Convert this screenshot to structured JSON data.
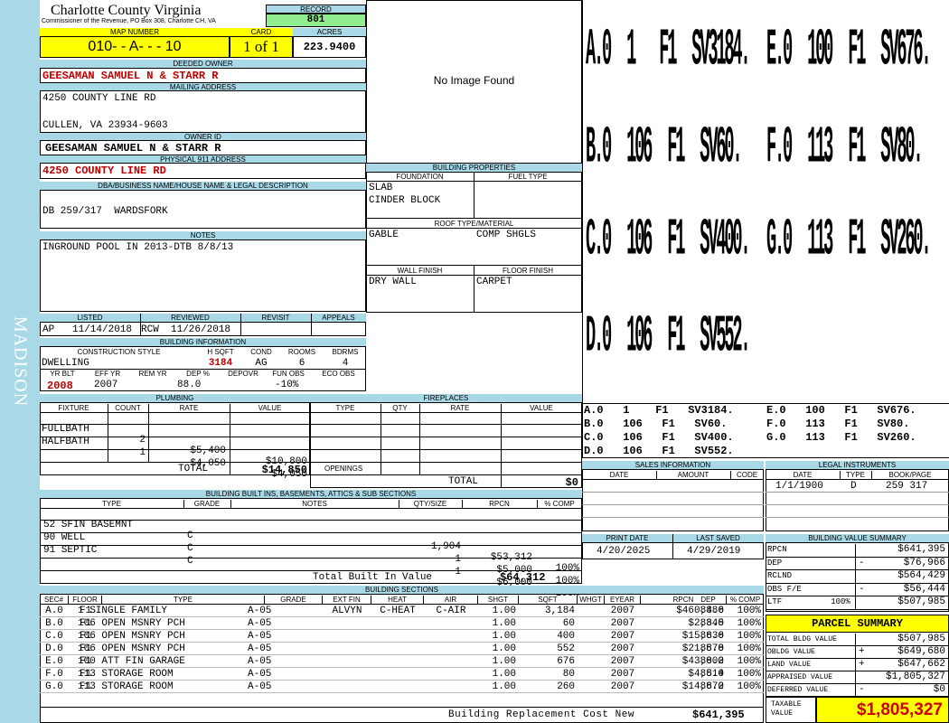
{
  "sidebar": {
    "label": "MADISON"
  },
  "header": {
    "county": "Charlotte County Virginia",
    "commissioner": "Commissioner of the Revenue, PO Box 308, Charlotte CH, VA",
    "record_label": "RECORD",
    "record": "801"
  },
  "parcel": {
    "map_label": "MAP NUMBER",
    "map": "010- - A- - - 10",
    "card_label": "CARD",
    "card": "1 of 1",
    "acres_label": "ACRES",
    "acres": "223.9400"
  },
  "owner": {
    "deeded_label": "DEEDED OWNER",
    "deeded": "GEESAMAN SAMUEL N & STARR R",
    "mailing_label": "MAILING ADDRESS",
    "mail1": "4250 COUNTY LINE RD",
    "mail2": "CULLEN, VA 23934-9603",
    "id_label": "OWNER ID",
    "id": "GEESAMAN SAMUEL N & STARR R",
    "phys_label": "PHYSICAL 911 ADDRESS",
    "phys": "4250 COUNTY LINE RD"
  },
  "dba": {
    "label": "DBA/BUSINESS NAME/HOUSE NAME & LEGAL DESCRIPTION",
    "value": "DB 259/317  WARDSFORK"
  },
  "notes": {
    "label": "NOTES",
    "value": "INGROUND POOL IN 2013-DTB 8/8/13"
  },
  "photo": {
    "text": "No Image Found"
  },
  "props": {
    "title": "BUILDING PROPERTIES",
    "foundation_label": "FOUNDATION",
    "fuel_label": "FUEL TYPE",
    "foundation1": "SLAB",
    "foundation2": "CINDER BLOCK",
    "roof_label": "ROOF TYPE/MATERIAL",
    "roof1": "GABLE",
    "roof2": "COMP SHGLS",
    "wall_label": "WALL FINISH",
    "floor_label": "FLOOR FINISH",
    "wall": "DRY WALL",
    "floor": "CARPET"
  },
  "review": {
    "listed_label": "LISTED",
    "reviewed_label": "REVIEWED",
    "revisit_label": "REVISIT",
    "appeals_label": "APPEALS",
    "listed": "AP   11/14/2018",
    "reviewed": "RCW  11/26/2018"
  },
  "bldg": {
    "title": "BUILDING INFORMATION",
    "cs_label": "CONSTRUCTION STYLE",
    "hsqft_label": "H SQFT",
    "cond_label": "COND",
    "rooms_label": "ROOMS",
    "bdrms_label": "BDRMS",
    "cs": "DWELLING",
    "hsqft": "3184",
    "cond": "AG",
    "rooms": "6",
    "bdrms": "4",
    "yrblt_label": "YR BLT",
    "effyr_label": "EFF YR",
    "remyr_label": "REM YR",
    "dep_label": "DEP %",
    "depovr_label": "DEPOVR",
    "funobs_label": "FUN OBS",
    "ecoobs_label": "ECO OBS",
    "yrblt": "2008",
    "effyr": "2007",
    "dep": "88.0",
    "funobs": "-10%"
  },
  "plumbing": {
    "title": "PLUMBING",
    "headers": [
      "FIXTURE",
      "COUNT",
      "RATE",
      "VALUE"
    ],
    "rows": [
      [
        "FULLBATH",
        "2",
        "$5,400",
        "$10,800"
      ],
      [
        "HALFBATH",
        "1",
        "$4,050",
        "$4,050"
      ]
    ],
    "total_label": "TOTAL",
    "total": "$14,850"
  },
  "fireplaces": {
    "title": "FIREPLACES",
    "headers": [
      "TYPE",
      "QTY",
      "RATE",
      "VALUE"
    ],
    "openings_label": "OPENINGS",
    "total_label": "TOTAL",
    "total": "$0"
  },
  "builtins": {
    "title": "BUILDING BUILT INS, BASEMENTS, ATTICS & SUB SECTIONS",
    "headers": [
      "TYPE",
      "GRADE",
      "NOTES",
      "QTY/SIZE",
      "RPCN",
      "% COMP"
    ],
    "rows": [
      [
        "52 SFIN BASEMNT",
        "C",
        "",
        "1,904",
        "$53,312",
        "100%"
      ],
      [
        "90 WELL",
        "C",
        "",
        "1",
        "$5,000",
        "100%"
      ],
      [
        "91 SEPTIC",
        "C",
        "",
        "1",
        "$6,000",
        "100%"
      ]
    ],
    "total_label": "Total Built In Value",
    "total": "$64,312"
  },
  "sections": {
    "title": "BUILDING SECTIONS",
    "headers": [
      "SEC#",
      "FLOOR",
      "TYPE",
      "GRADE",
      "EXT FIN",
      "HEAT",
      "AIR",
      "SHGT",
      "SQFT",
      "WHGT",
      "EYEAR",
      "RPCN",
      "DEP",
      "% COMP"
    ],
    "rows": [
      [
        "A.0",
        "F1",
        "1 SINGLE FAMILY",
        "A-05",
        "ALVYN",
        "C-HEAT",
        "C-AIR",
        "1.00",
        "3,184",
        "",
        "2007",
        "$460,486",
        "88.0",
        "100%"
      ],
      [
        "B.0",
        "F1",
        "106 OPEN MSNRY PCH",
        "A-05",
        "",
        "",
        "",
        "1.00",
        "60",
        "",
        "2007",
        "$2,345",
        "88.0",
        "100%"
      ],
      [
        "C.0",
        "F1",
        "106 OPEN MSNRY PCH",
        "A-05",
        "",
        "",
        "",
        "1.00",
        "400",
        "",
        "2007",
        "$15,636",
        "88.0",
        "100%"
      ],
      [
        "D.0",
        "F1",
        "106 OPEN MSNRY PCH",
        "A-05",
        "",
        "",
        "",
        "1.00",
        "552",
        "",
        "2007",
        "$21,578",
        "88.0",
        "100%"
      ],
      [
        "E.0",
        "F1",
        "100 ATT FIN GARAGE",
        "A-05",
        "",
        "",
        "",
        "1.00",
        "676",
        "",
        "2007",
        "$43,002",
        "88.0",
        "100%"
      ],
      [
        "F.0",
        "F1",
        "113 STORAGE ROOM",
        "A-05",
        "",
        "",
        "",
        "1.00",
        "80",
        "",
        "2007",
        "$4,514",
        "88.0",
        "100%"
      ],
      [
        "G.0",
        "F1",
        "113 STORAGE ROOM",
        "A-05",
        "",
        "",
        "",
        "1.00",
        "260",
        "",
        "2007",
        "$14,672",
        "88.0",
        "100%"
      ]
    ],
    "brcn_label": "Building Replacement Cost New",
    "brcn": "$641,395"
  },
  "sketch": {
    "big": [
      "A.0  1   F1  SV3184.",
      "E.0  100  F1  SV676.",
      "B.0  106  F1  SV60.",
      "F.0  113  F1  SV80.",
      "C.0  106  F1  SV400.",
      "G.0  113  F1  SV260.",
      "D.0  106  F1  SV552."
    ],
    "small": [
      "A.0   1    F1   SV3184.",
      "E.0   100   F1   SV676.",
      "B.0   106   F1   SV60.",
      "F.0   113   F1   SV80.",
      "C.0   106   F1   SV400.",
      "G.0   113   F1   SV260.",
      "D.0   106   F1   SV552."
    ]
  },
  "sales": {
    "title": "SALES INFORMATION",
    "date_label": "DATE",
    "amount_label": "AMOUNT",
    "code_label": "CODE"
  },
  "legal": {
    "title": "LEGAL INSTRUMENTS",
    "date_label": "DATE",
    "type_label": "TYPE",
    "book_label": "BOOK/PAGE",
    "date": "1/1/1900",
    "type": "D",
    "book": "259 317"
  },
  "dates": {
    "print_label": "PRINT DATE",
    "saved_label": "LAST SAVED",
    "print": "4/20/2025",
    "saved": "4/29/2019"
  },
  "bvs": {
    "title": "BUILDING VALUE SUMMARY",
    "rows": [
      [
        "RPCN",
        "",
        "$641,395"
      ],
      [
        "DEP",
        "-",
        "$76,966"
      ],
      [
        "RCLND",
        "",
        "$564,429"
      ],
      [
        "OBS F/E",
        "-",
        "$56,444"
      ],
      [
        "LTF          100%",
        "",
        "$507,985"
      ]
    ]
  },
  "summary": {
    "title": "PARCEL SUMMARY",
    "rows": [
      [
        "TOTAL BLDG VALUE",
        "",
        "$507,985"
      ],
      [
        "OBLDG VALUE",
        "+",
        "$649,680"
      ],
      [
        "LAND VALUE",
        "+",
        "$647,662"
      ],
      [
        "APPRAISED VALUE",
        "",
        "$1,805,327"
      ],
      [
        "DEFERRED VALUE",
        "-",
        "$0"
      ]
    ],
    "taxable_label1": "TAXABLE",
    "taxable_label2": "VALUE",
    "taxable": "$1,805,327"
  }
}
